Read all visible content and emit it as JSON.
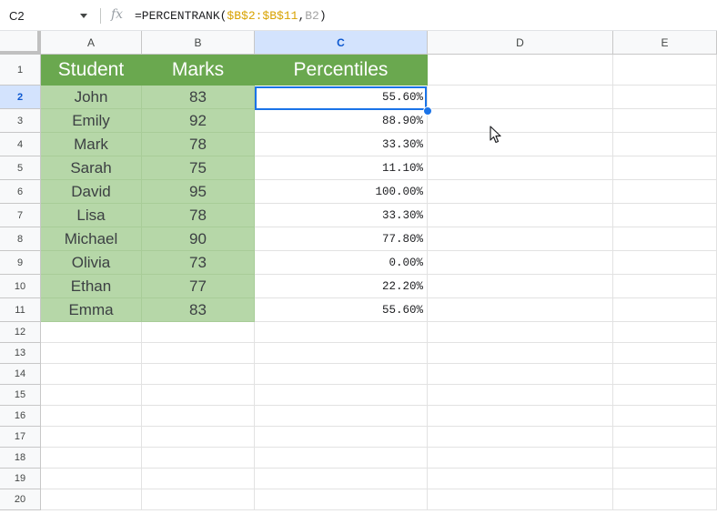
{
  "formula_bar": {
    "cell_ref": "C2",
    "fx_label": "fx",
    "formula_prefix": "=PERCENTRANK(",
    "formula_ref1": "$B$2:$B$11",
    "formula_sep": ",",
    "formula_ref2": "B2",
    "formula_suffix": ")"
  },
  "columns": [
    "A",
    "B",
    "C",
    "D",
    "E"
  ],
  "selected_column": "C",
  "row_numbers": [
    "1",
    "2",
    "3",
    "4",
    "5",
    "6",
    "7",
    "8",
    "9",
    "10",
    "11",
    "12",
    "13",
    "14",
    "15",
    "16",
    "17",
    "18",
    "19",
    "20"
  ],
  "selected_row": "2",
  "header": {
    "student": "Student",
    "marks": "Marks",
    "percentiles": "Percentiles"
  },
  "rows": [
    {
      "student": "John",
      "marks": "83",
      "percentile": "55.60%"
    },
    {
      "student": "Emily",
      "marks": "92",
      "percentile": "88.90%"
    },
    {
      "student": "Mark",
      "marks": "78",
      "percentile": "33.30%"
    },
    {
      "student": "Sarah",
      "marks": "75",
      "percentile": "11.10%"
    },
    {
      "student": "David",
      "marks": "95",
      "percentile": "100.00%"
    },
    {
      "student": "Lisa",
      "marks": "78",
      "percentile": "33.30%"
    },
    {
      "student": "Michael",
      "marks": "90",
      "percentile": "77.80%"
    },
    {
      "student": "Olivia",
      "marks": "73",
      "percentile": "0.00%"
    },
    {
      "student": "Ethan",
      "marks": "77",
      "percentile": "22.20%"
    },
    {
      "student": "Emma",
      "marks": "83",
      "percentile": "55.60%"
    }
  ],
  "colors": {
    "header_green": "#6aa84f",
    "light_green": "#b6d7a8",
    "selection_blue": "#1a73e8"
  }
}
